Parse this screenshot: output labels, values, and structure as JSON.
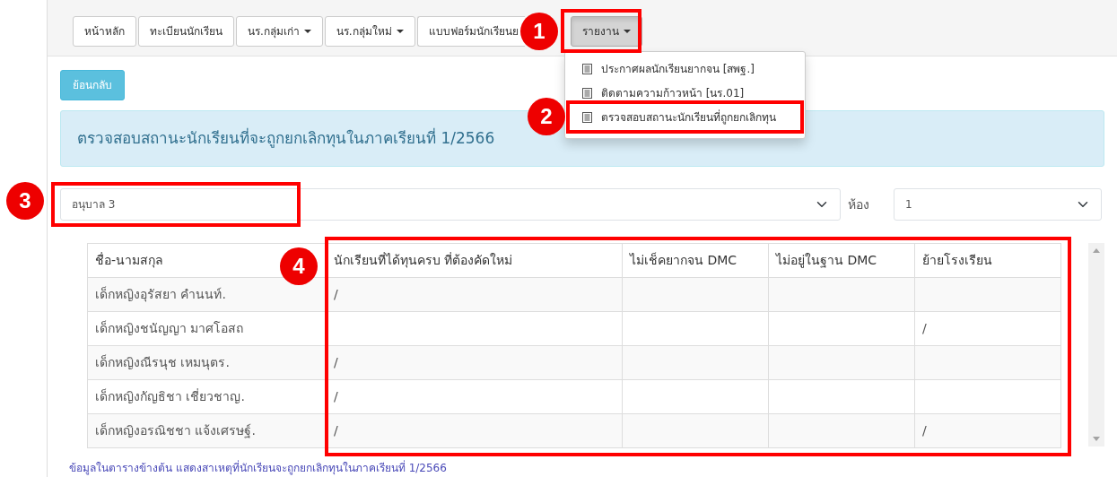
{
  "nav": {
    "items": [
      {
        "label": "หน้าหลัก",
        "dropdown": false,
        "active": false
      },
      {
        "label": "ทะเบียนนักเรียน",
        "dropdown": false,
        "active": false
      },
      {
        "label": "นร.กลุ่มเก่า",
        "dropdown": true,
        "active": false
      },
      {
        "label": "นร.กลุ่มใหม่",
        "dropdown": true,
        "active": false
      },
      {
        "label": "แบบฟอร์มนักเรียนย",
        "dropdown": false,
        "active": false
      },
      {
        "label": "รายงาน",
        "dropdown": true,
        "active": true
      }
    ]
  },
  "report_menu": {
    "items": [
      {
        "label": "ประกาศผลนักเรียนยากจน [สพฐ.]"
      },
      {
        "label": "ติดตามความก้าวหน้า [นร.01]"
      },
      {
        "label": "ตรวจสอบสถานะนักเรียนที่ถูกยกเลิกทุน"
      }
    ]
  },
  "back_button": "ย้อนกลับ",
  "alert": "ตรวจสอบสถานะนักเรียนที่จะถูกยกเลิกทุนในภาคเรียนที่ 1/2566",
  "class_select": {
    "value": "อนุบาล 3"
  },
  "room_label": "ห้อง",
  "room_select": {
    "value": "1"
  },
  "table": {
    "columns": [
      "ชื่อ-นามสกุล",
      "นักเรียนที่ได้ทุนครบ ที่ต้องคัดใหม่",
      "ไม่เช็คยากจน DMC",
      "ไม่อยู่ในฐาน DMC",
      "ย้ายโรงเรียน"
    ],
    "rows": [
      {
        "name": "เด็กหญิงอุรัสยา คำนนท์.",
        "cells": [
          "/",
          null,
          null,
          null
        ]
      },
      {
        "name": "เด็กหญิงชนัญญา มาศโอสถ",
        "cells": [
          null,
          null,
          null,
          "/"
        ]
      },
      {
        "name": "เด็กหญิงณีรนุช เหมนุตร.",
        "cells": [
          "/",
          null,
          null,
          null
        ]
      },
      {
        "name": "เด็กหญิงกัญธิชา เชี่ยวชาญ.",
        "cells": [
          "/",
          null,
          null,
          null
        ]
      },
      {
        "name": "เด็กหญิงอรณิชชา แจ้งเศรษฐ์.",
        "cells": [
          "/",
          null,
          null,
          "/"
        ]
      }
    ]
  },
  "footnote": "ข้อมูลในตารางข้างต้น แสดงสาเหตุที่นักเรียนจะถูกยกเลิกทุนในภาคเรียนที่ 1/2566",
  "annotations": [
    {
      "number": "1"
    },
    {
      "number": "2"
    },
    {
      "number": "3"
    },
    {
      "number": "4"
    }
  ]
}
